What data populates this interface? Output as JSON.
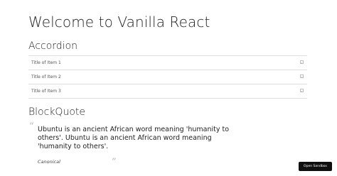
{
  "page": {
    "title": "Welcome to Vanilla React"
  },
  "accordion": {
    "heading": "Accordion",
    "items": [
      {
        "label": "Title of Item 1",
        "icon": "expand-icon"
      },
      {
        "label": "Title of Item 2",
        "icon": "expand-icon"
      },
      {
        "label": "Title of Item 3",
        "icon": "expand-icon"
      }
    ]
  },
  "blockquote": {
    "heading": "BlockQuote",
    "open_quote": "“",
    "close_quote": "”",
    "text": "Ubuntu is an ancient African word meaning 'humanity to others'. Ubuntu is an ancient African word meaning 'humanity to others'.",
    "cite": "Canonical"
  },
  "sandbox": {
    "button_label": "Open Sandbox",
    "background": "#0f0f0f",
    "color": "#ffffff"
  }
}
